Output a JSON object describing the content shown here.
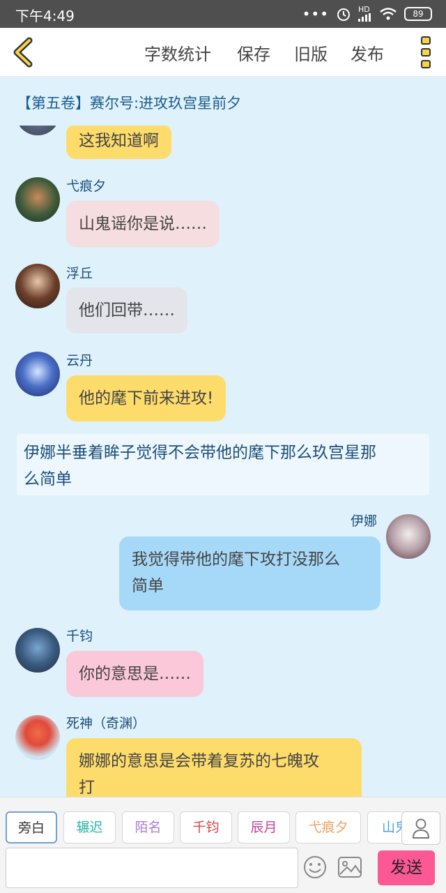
{
  "status": {
    "time": "下午4:49",
    "battery": "89",
    "dots": "•••",
    "network_label": "HD"
  },
  "toolbar": {
    "word_count": "字数统计",
    "save": "保存",
    "old_version": "旧版",
    "publish": "发布"
  },
  "chapter_title": "【第五卷】赛尔号:进攻玖宫星前夕",
  "messages": [
    {
      "text": "这我知道啊",
      "color": "#fddc6c"
    },
    {
      "name": "弋痕夕",
      "text": "山鬼谣你是说……",
      "color": "#f6dde0"
    },
    {
      "name": "浮丘",
      "text": "他们回带……",
      "color": "#e3e5ea"
    },
    {
      "name": "云丹",
      "text": "他的麾下前来进攻!",
      "color": "#fddc6c"
    },
    {
      "name": "伊娜",
      "text_line1": "我觉得带他的麾下攻打没那么",
      "text_line2": "简单",
      "color": "#a6d9f8"
    },
    {
      "name": "千钧",
      "text": "你的意思是……",
      "color": "#fbc8d9"
    },
    {
      "name": "死神（奇渊）",
      "text_line1": "娜娜的意思是会带着复苏的七魄攻",
      "text_line2": "打",
      "color": "#fddc6c"
    }
  ],
  "narration": {
    "line1": "伊娜半垂着眸子觉得不会带他的麾下那么玖宫星那",
    "line2": "么简单"
  },
  "characters": [
    {
      "label": "旁白",
      "color": "#555555"
    },
    {
      "label": "辗迟",
      "color": "#2bb5a5"
    },
    {
      "label": "陌名",
      "color": "#b07ad6"
    },
    {
      "label": "千钧",
      "color": "#e04545"
    },
    {
      "label": "辰月",
      "color": "#c2459a"
    },
    {
      "label": "弋痕夕",
      "color": "#f0a060"
    },
    {
      "label": "山鬼",
      "color": "#4aa6d8"
    }
  ],
  "input": {
    "value": "",
    "placeholder": ""
  },
  "send_label": "发送"
}
